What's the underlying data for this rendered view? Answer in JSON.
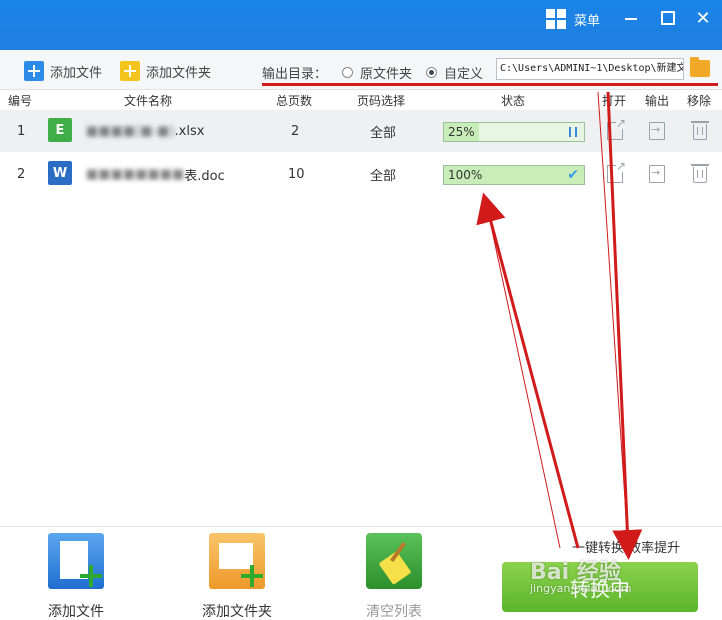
{
  "titlebar": {
    "menu_label": "菜单",
    "close_glyph": "✕"
  },
  "toolbar": {
    "add_file_label": "添加文件",
    "add_folder_label": "添加文件夹",
    "output_dir_label": "输出目录：",
    "radio_original": "原文件夹",
    "radio_custom": "自定义",
    "selected_radio": "自定义",
    "output_path": "C:\\Users\\ADMINI~1\\Desktop\\新建文"
  },
  "table": {
    "headers": {
      "index": "编号",
      "name": "文件名称",
      "pages": "总页数",
      "page_select": "页码选择",
      "status": "状态",
      "open": "打开",
      "output": "输出",
      "remove": "移除"
    },
    "rows": [
      {
        "index": "1",
        "icon_letter": "E",
        "name_hidden": "■■■■(■-■)",
        "name_ext": ".xlsx",
        "pages": "2",
        "page_select": "全部",
        "status": "25%",
        "progress": 0.25,
        "state": "paused"
      },
      {
        "index": "2",
        "icon_letter": "W",
        "name_hidden": "■■■■■■■■",
        "name_ext": "表.doc",
        "pages": "10",
        "page_select": "全部",
        "status": "100%",
        "progress": 1.0,
        "state": "done"
      }
    ]
  },
  "bottom": {
    "add_file_label": "添加文件",
    "add_folder_label": "添加文件夹",
    "clear_list_label": "清空列表",
    "slogan": "一键转换  效率提升",
    "convert_label": "转换中"
  },
  "watermark": {
    "brand": "Bai 经验",
    "url": "jingyan.baidu.com"
  },
  "colors": {
    "titlebar": "#1f7fe0",
    "annotation_red": "#d11a1a",
    "convert_green": "#6cc23a"
  }
}
